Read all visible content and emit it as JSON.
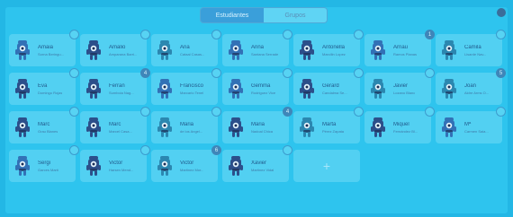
{
  "tabs": [
    {
      "label": "Estudiantes",
      "active": true
    },
    {
      "label": "Grupos",
      "active": false
    }
  ],
  "students": [
    {
      "name": "Amaia",
      "sub": "Sorna Beringu...",
      "badge": "",
      "monster": "blue"
    },
    {
      "name": "Amalio",
      "sub": "Amparana Barri...",
      "badge": "",
      "monster": "navy"
    },
    {
      "name": "Ana",
      "sub": "Cataal Casas...",
      "badge": "",
      "monster": "teal"
    },
    {
      "name": "Anna",
      "sub": "Santana Serrade",
      "badge": "",
      "monster": "blue"
    },
    {
      "name": "Antonella",
      "sub": "Marcilin Lopez",
      "badge": "",
      "monster": "navy"
    },
    {
      "name": "Arnau",
      "sub": "Ramos Planas",
      "badge": "1",
      "monster": "blue"
    },
    {
      "name": "Camila",
      "sub": "Lisarde Nav...",
      "badge": "",
      "monster": "teal"
    },
    {
      "name": "Eva",
      "sub": "Domingo Rojas",
      "badge": "",
      "monster": "navy"
    },
    {
      "name": "Ferran",
      "sub": "Sumboia Nag...",
      "badge": "4",
      "monster": "navy"
    },
    {
      "name": "Francisco",
      "sub": "Marcario Tenel",
      "badge": "",
      "monster": "blue"
    },
    {
      "name": "Gemma",
      "sub": "Rodriguez Vice",
      "badge": "",
      "monster": "blue"
    },
    {
      "name": "Gerard",
      "sub": "Candalma Se...",
      "badge": "",
      "monster": "navy"
    },
    {
      "name": "Javier",
      "sub": "Lozano Blanc",
      "badge": "",
      "monster": "teal"
    },
    {
      "name": "Joan",
      "sub": "Aldre Arms O...",
      "badge": "5",
      "monster": "teal"
    },
    {
      "name": "Marc",
      "sub": "Grau Blanes",
      "badge": "",
      "monster": "navy"
    },
    {
      "name": "Marc",
      "sub": "Marcel Casa...",
      "badge": "",
      "monster": "navy"
    },
    {
      "name": "Maria",
      "sub": "de los Angel...",
      "badge": "",
      "monster": "teal"
    },
    {
      "name": "Maria",
      "sub": "Nadoal Chica",
      "badge": "4",
      "monster": "navy"
    },
    {
      "name": "Marta",
      "sub": "Pérez Zapata",
      "badge": "",
      "monster": "teal"
    },
    {
      "name": "Miquel",
      "sub": "Fernández Bl...",
      "badge": "",
      "monster": "navy"
    },
    {
      "name": "Mª",
      "sub": "Carmen Sala...",
      "badge": "",
      "monster": "blue"
    },
    {
      "name": "Sergi",
      "sub": "Garces Martí",
      "badge": "",
      "monster": "blue"
    },
    {
      "name": "Victor",
      "sub": "Harsen Mend...",
      "badge": "",
      "monster": "navy"
    },
    {
      "name": "Victor",
      "sub": "Martinez Mor...",
      "badge": "6",
      "monster": "teal"
    },
    {
      "name": "Xavier",
      "sub": "Martinez Vidal",
      "badge": "",
      "monster": "navy"
    }
  ],
  "add_label": "+",
  "colors": {
    "blue": "#3271b6",
    "navy": "#2c4f8a",
    "teal": "#2b87b0"
  },
  "icons": {
    "settings": "settings-icon",
    "add": "plus-icon",
    "avatar": "monster-avatar-icon"
  }
}
